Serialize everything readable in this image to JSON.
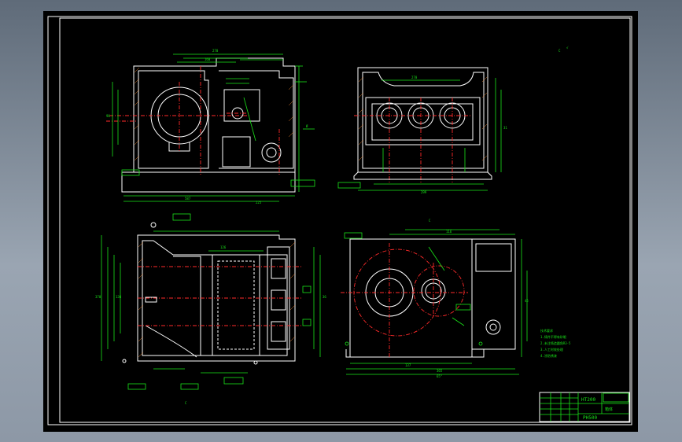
{
  "drawing": {
    "title_block": {
      "material": "HT200",
      "part_name": "PH500",
      "sub_label": "箱体"
    },
    "section_labels": {
      "top_right": "C",
      "bottom_left": "C"
    },
    "roughness_mark": "√",
    "notes": [
      "技术要求",
      "1.铸件不得有砂眼",
      "2.未注铸造圆角R3-5",
      "3.人工时效处理",
      "4.涂防锈漆"
    ]
  }
}
